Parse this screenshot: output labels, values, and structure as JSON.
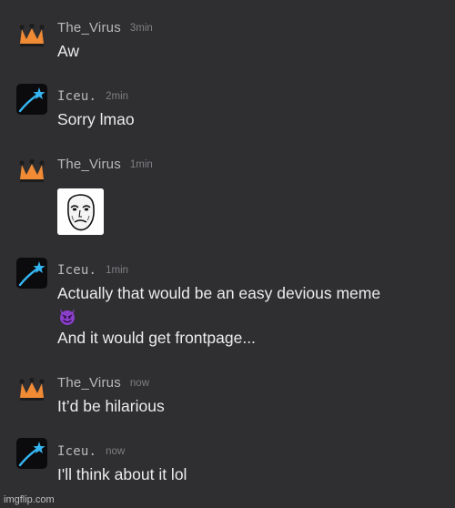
{
  "messages": [
    {
      "username": "The_Virus",
      "time": "3min",
      "avatar": "crown-icon",
      "lines": [
        "Aw"
      ]
    },
    {
      "username": "Iceu.",
      "time": "2min",
      "avatar": "shooting-star-icon",
      "lines": [
        "Sorry lmao"
      ]
    },
    {
      "username": "The_Virus",
      "time": "1min",
      "avatar": "crown-icon",
      "attachment": "meme-face-sticker"
    },
    {
      "username": "Iceu.",
      "time": "1min",
      "avatar": "shooting-star-icon",
      "lines": [
        "Actually that would be an easy devious meme",
        "😈",
        "And it would get frontpage..."
      ]
    },
    {
      "username": "The_Virus",
      "time": "now",
      "avatar": "crown-icon",
      "lines": [
        "It’d be hilarious"
      ]
    },
    {
      "username": "Iceu.",
      "time": "now",
      "avatar": "shooting-star-icon",
      "lines": [
        "I'll think about it lol"
      ]
    }
  ],
  "watermark": "imgflip.com",
  "colors": {
    "background": "#2f2f31",
    "crown": "#f08a35",
    "star": "#35b6f2",
    "username": "#b9b9bc",
    "timestamp": "#7f7f83",
    "message_text": "#ececee",
    "devil_emoji": "#8a3fc9"
  }
}
